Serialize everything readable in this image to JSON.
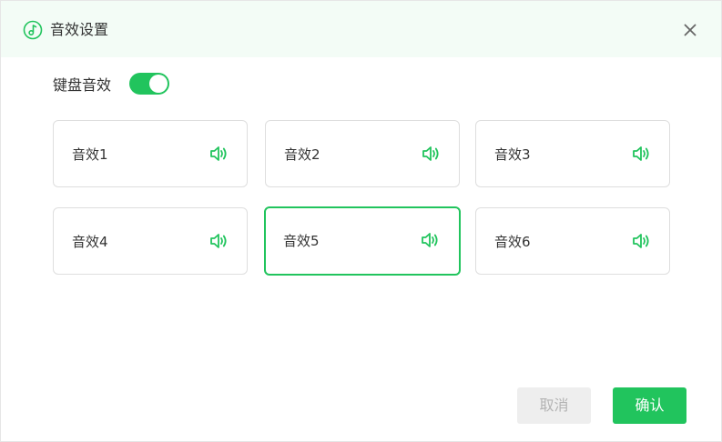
{
  "dialog": {
    "title": "音效设置",
    "title_icon": "music-note-icon",
    "close_icon": "close-icon"
  },
  "keyboard_sound": {
    "label": "键盘音效",
    "enabled": true
  },
  "sounds": [
    {
      "label": "音效1",
      "selected": false
    },
    {
      "label": "音效2",
      "selected": false
    },
    {
      "label": "音效3",
      "selected": false
    },
    {
      "label": "音效4",
      "selected": false
    },
    {
      "label": "音效5",
      "selected": true
    },
    {
      "label": "音效6",
      "selected": false
    }
  ],
  "speaker_icon": "speaker-icon",
  "buttons": {
    "cancel": "取消",
    "confirm": "确认"
  },
  "colors": {
    "accent": "#21c45d",
    "header_bg": "#f3fcf6"
  }
}
